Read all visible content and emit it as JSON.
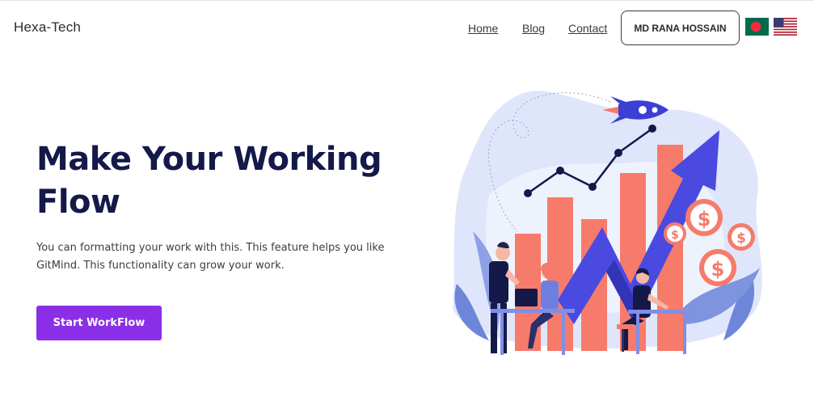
{
  "header": {
    "brand": "Hexa-Tech",
    "nav": [
      "Home",
      "Blog",
      "Contact"
    ],
    "user_button": "MD RANA HOSSAIN",
    "flags": [
      "bangladesh-flag",
      "usa-flag"
    ]
  },
  "hero": {
    "title_line1": "Make Your Working",
    "title_line2": "Flow",
    "description_line1": "You can formatting your work with this. This feature helps you like",
    "description_line2": "GitMind. This functionality can grow your work.",
    "cta_label": "Start WorkFlow"
  },
  "illustration": {
    "dollar_symbol": "$"
  },
  "colors": {
    "accent": "#8b2ee8",
    "title": "#14194a",
    "bar": "#f77b6a",
    "arrow": "#4a4ae0",
    "bg_blob": "#dfe6fb"
  }
}
